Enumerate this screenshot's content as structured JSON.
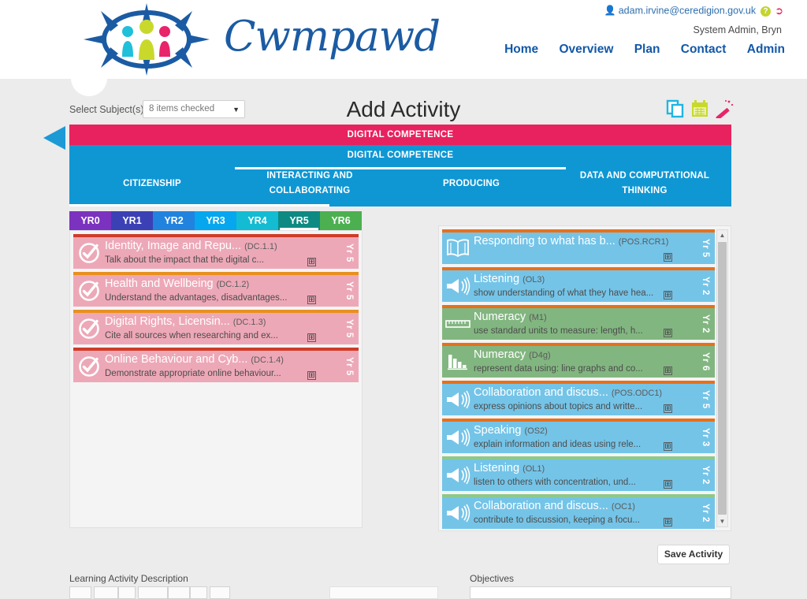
{
  "header": {
    "brand": "Cwmpawd",
    "user_email": "adam.irvine@ceredigion.gov.uk",
    "org": "System Admin, Bryn",
    "help_badge": "?",
    "nav": [
      {
        "label": "Home"
      },
      {
        "label": "Overview"
      },
      {
        "label": "Plan"
      },
      {
        "label": "Contact"
      },
      {
        "label": "Admin"
      }
    ]
  },
  "subbar": {
    "select_label": "Select Subject(s)",
    "select_value": "8 items checked",
    "caret": "▼",
    "page_title": "Add Activity",
    "tools": [
      {
        "name": "copy-icon"
      },
      {
        "name": "calendar-icon"
      },
      {
        "name": "magic-wand-icon"
      }
    ]
  },
  "banner": {
    "top_band": "DIGITAL COMPETENCE",
    "second_band": "DIGITAL COMPETENCE",
    "segments": [
      "CITIZENSHIP",
      "INTERACTING AND COLLABORATING",
      "PRODUCING",
      "DATA AND COMPUTATIONAL THINKING"
    ],
    "colors": {
      "pink": "#e8225f",
      "blue": "#0f97d4"
    }
  },
  "year_tabs": [
    {
      "label": "YR0",
      "color": "#7b32bf",
      "active": false
    },
    {
      "label": "YR1",
      "color": "#3b41b5",
      "active": false
    },
    {
      "label": "YR2",
      "color": "#2183de",
      "active": false
    },
    {
      "label": "YR3",
      "color": "#06a7ef",
      "active": false
    },
    {
      "label": "YR4",
      "color": "#13bcd2",
      "active": false
    },
    {
      "label": "YR5",
      "color": "#0e8a82",
      "active": true
    },
    {
      "label": "YR6",
      "color": "#4cb050",
      "active": false
    }
  ],
  "left_panel": {
    "cards": [
      {
        "title": "Identity, Image and Repu...",
        "code": "(DC.1.1)",
        "desc": "Talk about the impact that the digital c...",
        "year": "Yr 5",
        "icon": "check-circle-icon",
        "bg": "#eda8b7",
        "stripe": "#cf3b28",
        "plus": "⊞"
      },
      {
        "title": "Health and Wellbeing",
        "code": "(DC.1.2)",
        "desc": "Understand the advantages, disadvantages...",
        "year": "Yr 5",
        "icon": "check-circle-icon",
        "bg": "#eda8b7",
        "stripe": "#e8901f",
        "plus": "⊞"
      },
      {
        "title": "Digital Rights, Licensin...",
        "code": "(DC.1.3)",
        "desc": "Cite all sources when researching and ex...",
        "year": "Yr 5",
        "icon": "check-circle-icon",
        "bg": "#eda8b7",
        "stripe": "#e8901f",
        "plus": "⊞"
      },
      {
        "title": "Online Behaviour and Cyb...",
        "code": "(DC.1.4)",
        "desc": "Demonstrate appropriate online behaviour...",
        "year": "Yr 5",
        "icon": "check-circle-icon",
        "bg": "#eda8b7",
        "stripe": "#cf3b28",
        "plus": "⊞"
      }
    ]
  },
  "right_panel": {
    "cards": [
      {
        "title": "Responding to what has b...",
        "code": "(POS.RCR1)",
        "desc": "",
        "year": "Yr 5",
        "icon": "open-book-icon",
        "bg": "#74c4e8",
        "stripe": "#e8701a",
        "plus": "⊞"
      },
      {
        "title": "Listening",
        "code": "(OL3)",
        "desc": "show understanding of what they have hea...",
        "year": "Yr 2",
        "icon": "megaphone-icon",
        "bg": "#74c4e8",
        "stripe": "#e8701a",
        "plus": "⊞"
      },
      {
        "title": "Numeracy",
        "code": "(M1)",
        "desc": "use standard units to measure: length, h...",
        "year": "Yr 2",
        "icon": "ruler-icon",
        "bg": "#82b680",
        "stripe": "#e8701a",
        "plus": "⊞"
      },
      {
        "title": "Numeracy",
        "code": "(D4g)",
        "desc": "represent data using: line graphs and co...",
        "year": "Yr 6",
        "icon": "bar-chart-icon",
        "bg": "#82b680",
        "stripe": "#e8701a",
        "plus": "⊞"
      },
      {
        "title": "Collaboration and discus...",
        "code": "(POS.ODC1)",
        "desc": "express opinions about topics and writte...",
        "year": "Yr 5",
        "icon": "megaphone-icon",
        "bg": "#74c4e8",
        "stripe": "#e8701a",
        "plus": "⊞"
      },
      {
        "title": "Speaking",
        "code": "(OS2)",
        "desc": "explain information and ideas using rele...",
        "year": "Yr 3",
        "icon": "megaphone-icon",
        "bg": "#74c4e8",
        "stripe": "#e8701a",
        "plus": "⊞"
      },
      {
        "title": "Listening",
        "code": "(OL1)",
        "desc": "listen to others with concentration, und...",
        "year": "Yr 2",
        "icon": "megaphone-icon",
        "bg": "#74c4e8",
        "stripe": "#8dc98a",
        "plus": "⊞"
      },
      {
        "title": "Collaboration and discus...",
        "code": "(OC1)",
        "desc": "contribute to discussion, keeping a focu...",
        "year": "Yr 2",
        "icon": "megaphone-icon",
        "bg": "#74c4e8",
        "stripe": "#8dc98a",
        "plus": "⊞"
      }
    ],
    "scroll_up": "▲",
    "scroll_down": "▼"
  },
  "footer": {
    "save_label": "Save Activity",
    "learning_activity_label": "Learning Activity Description",
    "objectives_label": "Objectives"
  }
}
